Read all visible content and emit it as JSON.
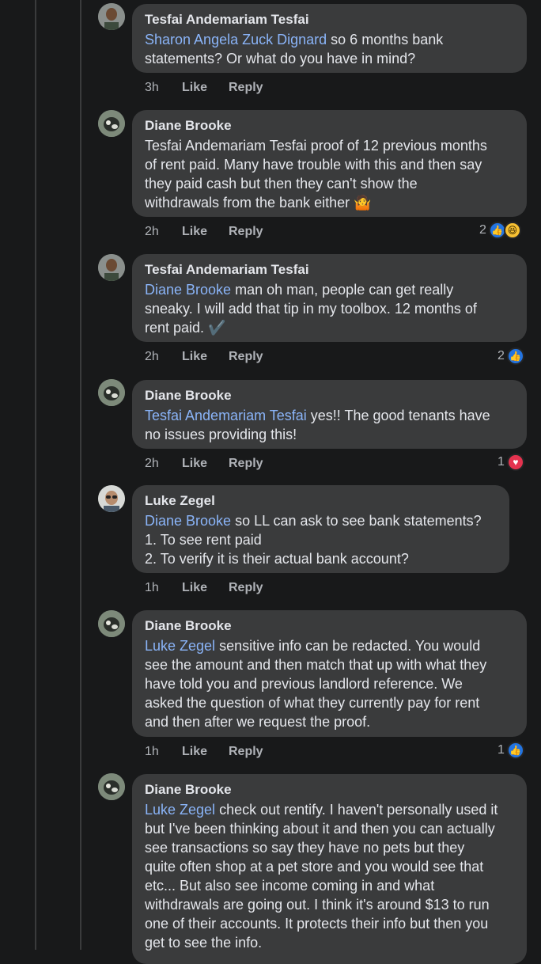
{
  "comments": [
    {
      "author": "Tesfai Andemariam Tesfai",
      "mention": "Sharon Angela Zuck Dignard",
      "body_lines": [
        "so 6 months bank",
        "statements? Or what do you have in mind?"
      ],
      "time": "3h",
      "like_label": "Like",
      "reply_label": "Reply",
      "reaction_count": "",
      "avatar": "man-avatar"
    },
    {
      "author": "Diane Brooke",
      "mention": "",
      "body_lines": [
        "Tesfai Andemariam Tesfai proof of 12 previous months",
        "of rent paid. Many have trouble with this and then say",
        "they paid cash but then they can't show the",
        "withdrawals from the bank either 🤷"
      ],
      "time": "2h",
      "like_label": "Like",
      "reply_label": "Reply",
      "reaction_count": "2",
      "reactions": [
        "like",
        "haha"
      ],
      "avatar": "dog-avatar"
    },
    {
      "author": "Tesfai Andemariam Tesfai",
      "mention": "Diane Brooke",
      "body_lines": [
        "man oh man,  people can get really",
        "sneaky.  I will add that tip in my toolbox.  12 months of",
        "rent paid. ✔️"
      ],
      "time": "2h",
      "like_label": "Like",
      "reply_label": "Reply",
      "reaction_count": "2",
      "reactions": [
        "like"
      ],
      "avatar": "man-avatar"
    },
    {
      "author": "Diane Brooke",
      "mention": "Tesfai Andemariam Tesfai",
      "body_lines": [
        "yes!! The good tenants have",
        "no issues providing this!"
      ],
      "time": "2h",
      "like_label": "Like",
      "reply_label": "Reply",
      "reaction_count": "1",
      "reactions": [
        "love"
      ],
      "avatar": "dog-avatar"
    },
    {
      "author": "Luke Zegel",
      "mention": "Diane Brooke",
      "body_lines": [
        "so LL can ask to see bank statements?",
        "1. To see rent paid",
        "2. To verify it is their actual bank account?"
      ],
      "time": "1h",
      "like_label": "Like",
      "reply_label": "Reply",
      "reaction_count": "",
      "avatar": "glasses-avatar"
    },
    {
      "author": "Diane Brooke",
      "mention": "Luke Zegel",
      "body_lines": [
        "sensitive info can be redacted. You would",
        "see the amount and then match that up with what they",
        "have told you and previous landlord reference. We",
        "asked the question of what they currently pay for rent",
        "and then after we request the proof."
      ],
      "time": "1h",
      "like_label": "Like",
      "reply_label": "Reply",
      "reaction_count": "1",
      "reactions": [
        "like"
      ],
      "avatar": "dog-avatar"
    },
    {
      "author": "Diane Brooke",
      "mention": "Luke Zegel",
      "body_lines": [
        "check out rentify. I haven't personally used it",
        "but I've been thinking about it and then you can actually",
        "see transactions so say they have no pets but they",
        "quite often shop at a pet store and you would see that",
        "etc... But also see income coming in and what",
        "withdrawals are going out. I think it's around $13 to run",
        "one of their accounts. It protects their info but then you",
        "get to see the info."
      ],
      "time": "",
      "like_label": "",
      "reply_label": "",
      "reaction_count": "",
      "avatar": "dog-avatar"
    }
  ]
}
